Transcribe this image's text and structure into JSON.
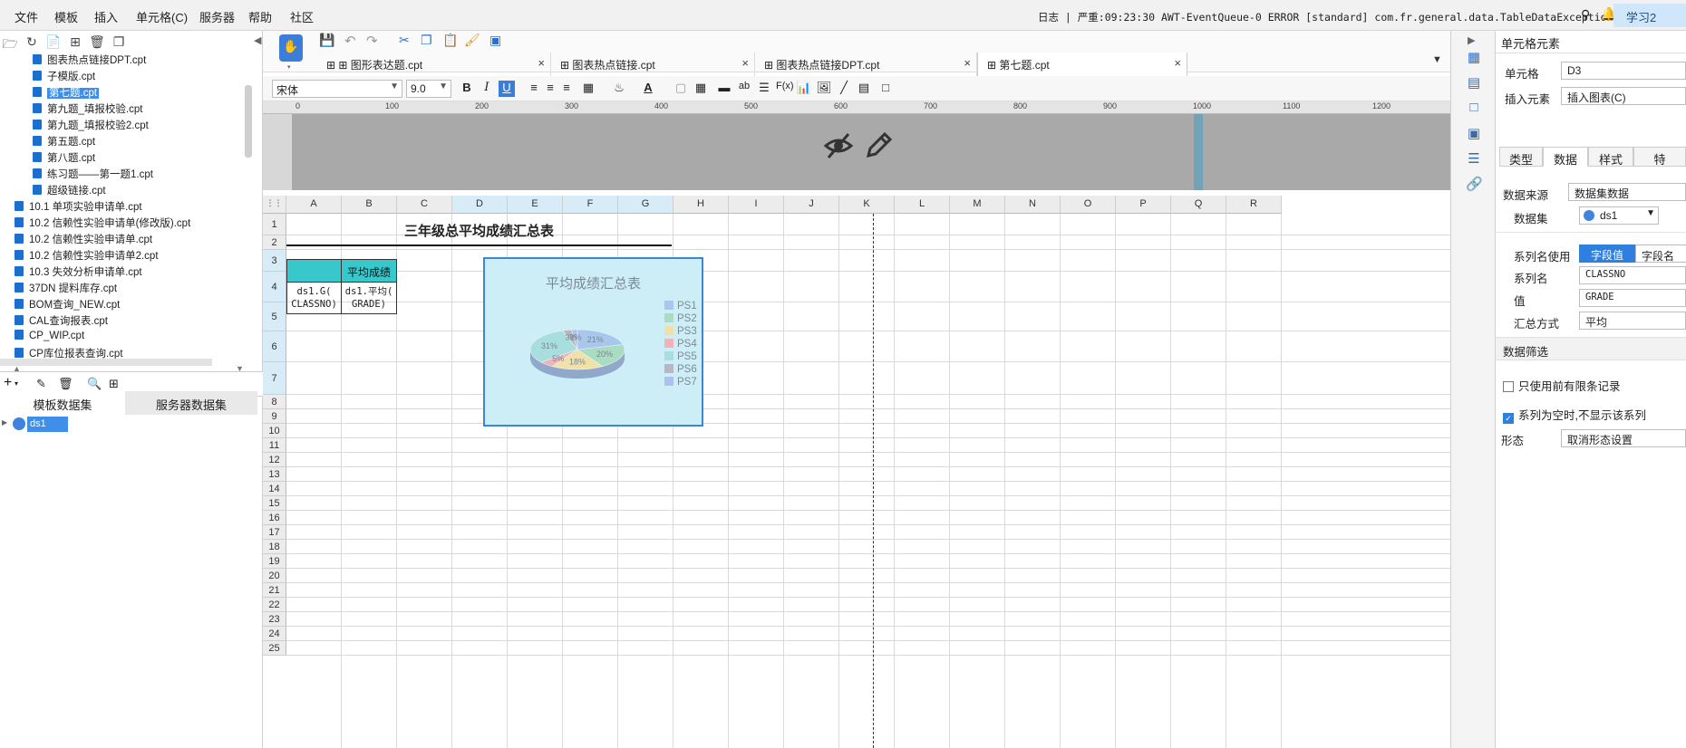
{
  "menu": {
    "items": [
      "文件",
      "模板",
      "插入",
      "单元格(C)",
      "服务器",
      "帮助",
      "社区"
    ]
  },
  "status": {
    "log_line": "日志 | 严重:09:23:30 AWT-EventQueue-0 ERROR [standard] com.fr.general.data.TableDataException: 错...",
    "study_button": "学习2"
  },
  "file_tree": {
    "items": [
      {
        "label": "图表热点链接DPT.cpt",
        "indent": 2,
        "selected": false
      },
      {
        "label": "子模版.cpt",
        "indent": 2,
        "selected": false
      },
      {
        "label": "第七题.cpt",
        "indent": 2,
        "selected": true
      },
      {
        "label": "第九题_填报校验.cpt",
        "indent": 2,
        "selected": false
      },
      {
        "label": "第九题_填报校验2.cpt",
        "indent": 2,
        "selected": false
      },
      {
        "label": "第五题.cpt",
        "indent": 2,
        "selected": false
      },
      {
        "label": "第八题.cpt",
        "indent": 2,
        "selected": false
      },
      {
        "label": "练习题——第一题1.cpt",
        "indent": 2,
        "selected": false
      },
      {
        "label": "超级链接.cpt",
        "indent": 2,
        "selected": false
      },
      {
        "label": "10.1 单项实验申请单.cpt",
        "indent": 1,
        "selected": false
      },
      {
        "label": "10.2 信赖性实验申请单(修改版).cpt",
        "indent": 1,
        "selected": false
      },
      {
        "label": "10.2 信赖性实验申请单.cpt",
        "indent": 1,
        "selected": false
      },
      {
        "label": "10.2 信赖性实验申请单2.cpt",
        "indent": 1,
        "selected": false
      },
      {
        "label": "10.3 失效分析申请单.cpt",
        "indent": 1,
        "selected": false
      },
      {
        "label": "37DN 提料库存.cpt",
        "indent": 1,
        "selected": false
      },
      {
        "label": "BOM查询_NEW.cpt",
        "indent": 1,
        "selected": false
      },
      {
        "label": "CAL查询报表.cpt",
        "indent": 1,
        "selected": false
      },
      {
        "label": "CP_WIP.cpt",
        "indent": 1,
        "selected": false
      },
      {
        "label": "CP库位报表查询.cpt",
        "indent": 1,
        "selected": false
      }
    ]
  },
  "dataset_panel": {
    "tabs": [
      "模板数据集",
      "服务器数据集"
    ],
    "active_tab": 0,
    "datasets": [
      "ds1"
    ]
  },
  "doc_tabs": {
    "tabs": [
      {
        "label": "图形表达题.cpt",
        "active": false
      },
      {
        "label": "图表热点链接.cpt",
        "active": false
      },
      {
        "label": "图表热点链接DPT.cpt",
        "active": false
      },
      {
        "label": "第七题.cpt",
        "active": true
      }
    ]
  },
  "format_bar": {
    "font_name": "宋体",
    "font_size": "9.0"
  },
  "ruler": {
    "labels": [
      "0",
      "100",
      "200",
      "300",
      "400",
      "500",
      "600",
      "700",
      "800",
      "900",
      "1000",
      "1100",
      "1200"
    ]
  },
  "sheet": {
    "columns": [
      "A",
      "B",
      "C",
      "D",
      "E",
      "F",
      "G",
      "H",
      "I",
      "J",
      "K",
      "L",
      "M",
      "N",
      "O",
      "P",
      "Q",
      "R"
    ],
    "selected_columns": [
      "D",
      "E",
      "F",
      "G"
    ],
    "rows": [
      "1",
      "2",
      "3",
      "4",
      "5",
      "6",
      "7",
      "8",
      "9",
      "10",
      "11",
      "12",
      "13",
      "14",
      "15",
      "16",
      "17",
      "18",
      "19",
      "20",
      "21",
      "22",
      "23",
      "24",
      "25"
    ],
    "selected_rows": [
      "3",
      "4",
      "5",
      "6",
      "7"
    ],
    "title": "三年级总平均成绩汇总表",
    "header_b3": "平均成绩",
    "cell_a4": "ds1.G(\nCLASSNO)",
    "cell_b4": "ds1.平均(\nGRADE)"
  },
  "chart_data": {
    "type": "pie",
    "title": "平均成绩汇总表",
    "categories": [
      "PS1",
      "PS2",
      "PS3",
      "PS4",
      "PS5",
      "PS6",
      "PS7"
    ],
    "values": [
      21,
      20,
      18,
      5,
      31,
      3,
      2
    ],
    "value_labels": [
      "21%",
      "20%",
      "18%",
      "5%",
      "31%",
      "3%",
      "2%"
    ],
    "colors": [
      "#a9c6ec",
      "#a9dcc0",
      "#efe1a8",
      "#f2b3b8",
      "#a8dede",
      "#b7b7c3",
      "#aec2ee"
    ],
    "legend": "right",
    "style": "3d"
  },
  "cell_element": {
    "title": "单元格元素",
    "cell_label": "单元格",
    "cell_value": "D3",
    "insert_label": "插入元素",
    "insert_value": "插入图表(C)",
    "tabs": [
      "类型",
      "数据",
      "样式",
      "特"
    ],
    "active_tab": 1,
    "source_label": "数据来源",
    "source_value": "数据集数据",
    "dataset_label": "数据集",
    "dataset_value": "ds1",
    "series_name_use_label": "系列名使用",
    "series_toggle": [
      "字段值",
      "字段名"
    ],
    "series_name_label": "系列名",
    "series_name_value": "CLASSNO",
    "value_label": "值",
    "value_value": "GRADE",
    "summary_label": "汇总方式",
    "summary_value": "平均",
    "filter_title": "数据筛选",
    "filter_opt1": "只使用前有限条记录",
    "filter_opt1_checked": false,
    "filter_opt2": "系列为空时,不显示该系列",
    "filter_opt2_checked": true,
    "shape_label": "形态",
    "shape_value": "取消形态设置"
  }
}
